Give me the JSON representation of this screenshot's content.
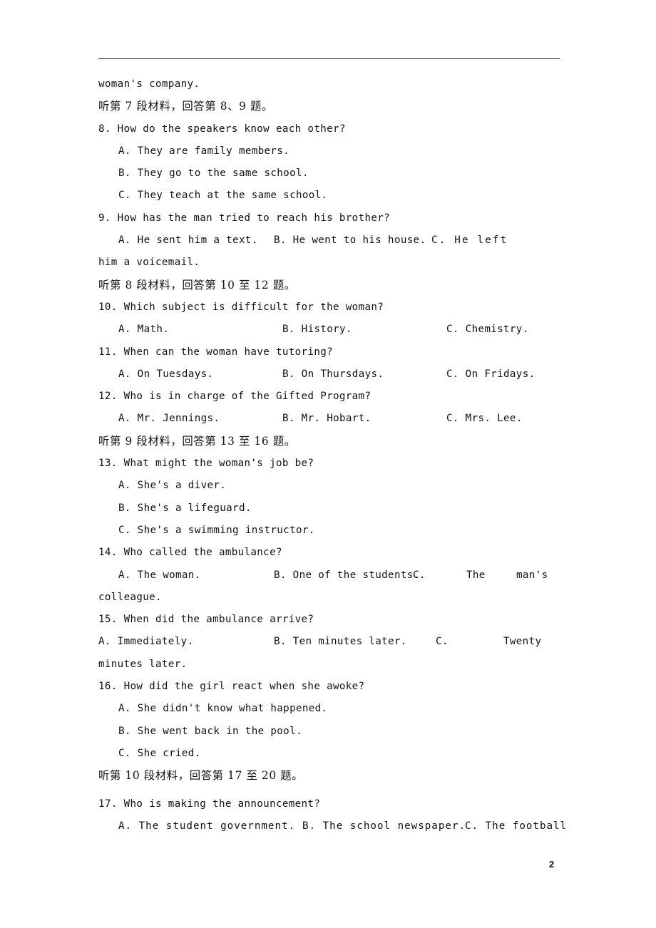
{
  "document": {
    "page_number": "2",
    "header_rule": true
  },
  "body": {
    "carryover_line": "woman's company.",
    "sections": [
      {
        "instruction": "听第 7 段材料，回答第 8、9 题。",
        "questions": [
          {
            "number": "8.",
            "stem": "8. How do the speakers know each other?",
            "layout": "stacked",
            "options": [
              "A. They are family members.",
              "B. They go to the same school.",
              "C. They teach at the same school."
            ]
          },
          {
            "number": "9.",
            "stem": "9. How has the man tried to reach his brother?",
            "layout": "row-wide",
            "options": [
              "A. He sent him a text.",
              "B. He went to his house.",
              "C. He left"
            ],
            "continuation": "him a voicemail."
          }
        ]
      },
      {
        "instruction": "听第 8 段材料，回答第 10 至 12 题。",
        "questions": [
          {
            "number": "10.",
            "stem": "10. Which subject is difficult for the woman?",
            "layout": "row",
            "options": [
              "A. Math.",
              "B. History.",
              "C. Chemistry."
            ]
          },
          {
            "number": "11.",
            "stem": "11. When can the woman have tutoring?",
            "layout": "row",
            "options": [
              "A. On Tuesdays.",
              "B. On Thursdays.",
              "C. On Fridays."
            ]
          },
          {
            "number": "12.",
            "stem": "12. Who is in charge of the Gifted Program?",
            "layout": "row",
            "options": [
              "A. Mr. Jennings.",
              "B. Mr. Hobart.",
              "C. Mrs. Lee."
            ]
          }
        ]
      },
      {
        "instruction": "听第 9 段材料，回答第 13 至 16 题。",
        "questions": [
          {
            "number": "13.",
            "stem": "13. What might the woman's job be?",
            "layout": "stacked",
            "options": [
              "A. She's a diver.",
              "B. She's a lifeguard.",
              "C. She's a swimming instructor."
            ]
          },
          {
            "number": "14.",
            "stem": "14. Who called the ambulance?",
            "layout": "row-wide",
            "options": [
              "A. The woman.",
              "B. One of the students.",
              "C.",
              "The",
              "man's"
            ],
            "continuation": "colleague."
          },
          {
            "number": "15.",
            "stem": "15. When did the ambulance arrive?",
            "layout": "row-flush",
            "options": [
              "A. Immediately.",
              "B. Ten minutes later.",
              "C.",
              "Twenty"
            ],
            "continuation": "minutes later."
          },
          {
            "number": "16.",
            "stem": "16. How did the girl react when she awoke?",
            "layout": "stacked",
            "options": [
              "A. She didn't know what happened.",
              "B. She went back in the pool.",
              "C. She cried."
            ]
          }
        ]
      },
      {
        "instruction": "听第 10 段材料，回答第 17 至 20 题。",
        "questions": [
          {
            "number": "17.",
            "stem": "17. Who is making the announcement?",
            "layout": "row-wide",
            "options": [
              "A. The student government.",
              "B. The school newspaper.",
              "C. The football"
            ]
          }
        ]
      }
    ]
  }
}
